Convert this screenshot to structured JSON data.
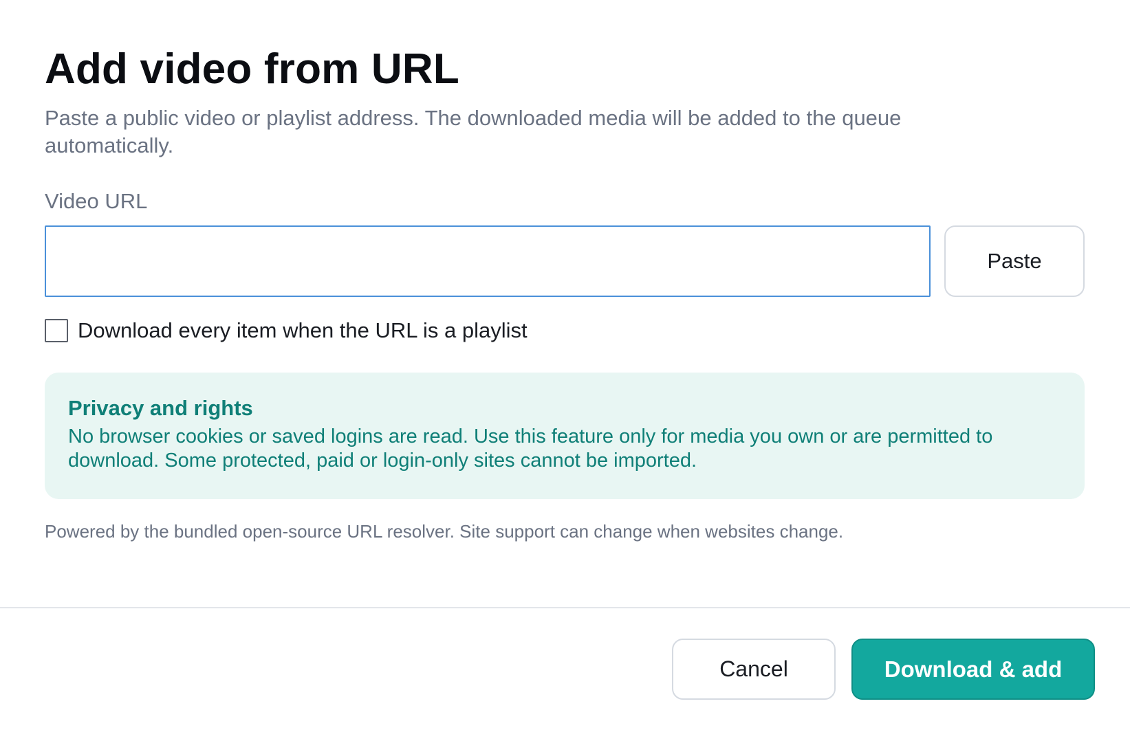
{
  "dialog": {
    "title": "Add video from URL",
    "subtitle": "Paste a public video or playlist address. The downloaded media will be added to the queue automatically."
  },
  "url_field": {
    "label": "Video URL",
    "value": "",
    "placeholder": "",
    "paste_label": "Paste"
  },
  "playlist_option": {
    "label": "Download every item when the URL is a playlist",
    "checked": false
  },
  "notice": {
    "title": "Privacy and rights",
    "text": "No browser cookies or saved logins are read. Use this feature only for media you own or are permitted to download. Some protected, paid or login-only sites cannot be imported."
  },
  "footnote": "Powered by the bundled open-source URL resolver. Site support can change when websites change.",
  "actions": {
    "cancel_label": "Cancel",
    "primary_label": "Download & add"
  },
  "colors": {
    "accent": "#13a89e",
    "notice_bg": "#e8f6f3",
    "notice_text": "#0f7f77",
    "input_focus_border": "#4a90d9"
  }
}
